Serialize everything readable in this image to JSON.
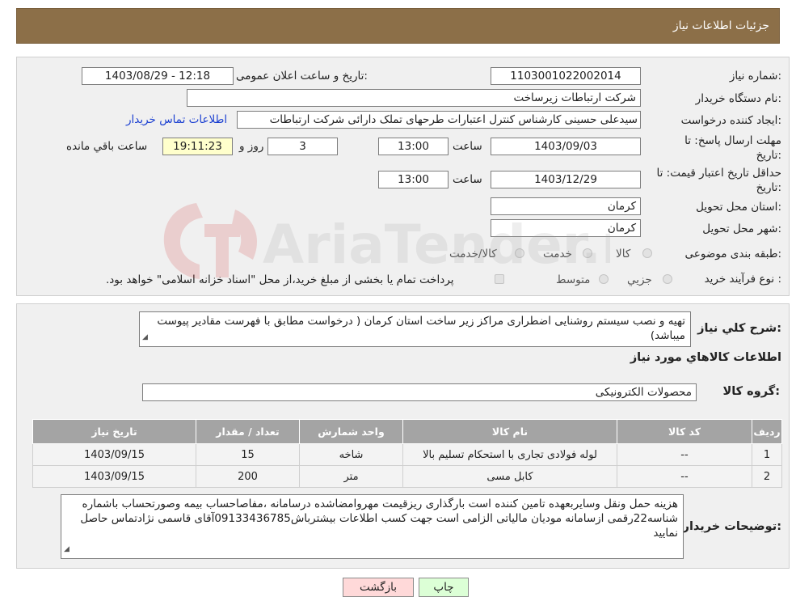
{
  "header": {
    "title": "جزئیات اطلاعات نیاز"
  },
  "form": {
    "need_number_label": "شماره نیاز:",
    "need_number": "1103001022002014",
    "announce_label": "تاریخ و ساعت اعلان عمومی:",
    "announce_value": "1403/08/29 - 12:18",
    "buyer_org_label": "نام دستگاه خریدار:",
    "buyer_org": "شرکت ارتباطات زیرساخت",
    "creator_label": "ایجاد کننده درخواست:",
    "creator": "سیدعلی حسینی کارشناس کنترل اعتبارات طرحهای تملک دارائی شرکت ارتباطات",
    "contact_link": "اطلاعات تماس خریدار",
    "deadline_label_1": "مهلت ارسال پاسخ: تا",
    "deadline_label_2": "تاریخ:",
    "deadline_date": "1403/09/03",
    "hour_label": "ساعت",
    "deadline_time": "13:00",
    "days_value": "3",
    "days_label": "روز و",
    "remaining_time": "19:11:23",
    "remaining_label": "ساعت باقي مانده",
    "validity_label_1": "حداقل تاریخ اعتبار قیمت: تا",
    "validity_label_2": "تاریخ:",
    "validity_date": "1403/12/29",
    "validity_hour_label": "ساعت",
    "validity_time": "13:00",
    "province_label": "استان محل تحویل:",
    "province": "کرمان",
    "city_label": "شهر محل تحویل:",
    "city": "کرمان",
    "category_label": "طبقه بندی موضوعی:",
    "category_options": [
      "کالا",
      "خدمت",
      "کالا/خدمت"
    ],
    "process_label": "نوع فرآیند خرید :",
    "process_options": [
      "جزیي",
      "متوسط"
    ],
    "payment_note": "پرداخت تمام یا بخشی از مبلغ خرید،از محل \"اسناد خزانه اسلامی\" خواهد بود."
  },
  "description": {
    "label": "شرح کلي نياز:",
    "text": "تهیه و نصب سیستم روشنایی اضطراری مراکز زیر ساخت استان کرمان ( درخواست مطابق با فهرست مقادیر پیوست میباشد)"
  },
  "goods": {
    "section_title": "اطلاعات کالاهاي مورد نياز",
    "group_label": "گروه کالا:",
    "group_value": "محصولات الکترونیکی",
    "columns": [
      "رديف",
      "کد کالا",
      "نام کالا",
      "واحد شمارش",
      "تعداد / مقدار",
      "تاريخ نياز"
    ],
    "rows": [
      [
        "1",
        "--",
        "لوله فولادی تجاری با استحکام تسلیم بالا",
        "شاخه",
        "15",
        "1403/09/15"
      ],
      [
        "2",
        "--",
        "کابل مسی",
        "متر",
        "200",
        "1403/09/15"
      ]
    ]
  },
  "buyer_notes": {
    "label": "توضیحات خریدار:",
    "text": "هزینه حمل ونقل وسایربعهده تامین کننده است بارگذاری ریزقیمت مهروامضاشده درسامانه ،مفاصاحساب بیمه وصورتحساب باشماره شناسه22رقمی ازسامانه مودیان مالیاتی الزامی است جهت کسب اطلاعات بیشترباش09133436785آقای قاسمی نژادتماس حاصل نمایید"
  },
  "buttons": {
    "print": "چاپ",
    "back": "بازگشت"
  },
  "watermark": {
    "text": "AriaTender.neT"
  },
  "colors": {
    "header_bg": "#8c6f48",
    "link": "#1a3fd1",
    "table_head": "#a4a4a4",
    "back_btn": "#ffd9d9",
    "print_btn": "#dcffd6"
  }
}
